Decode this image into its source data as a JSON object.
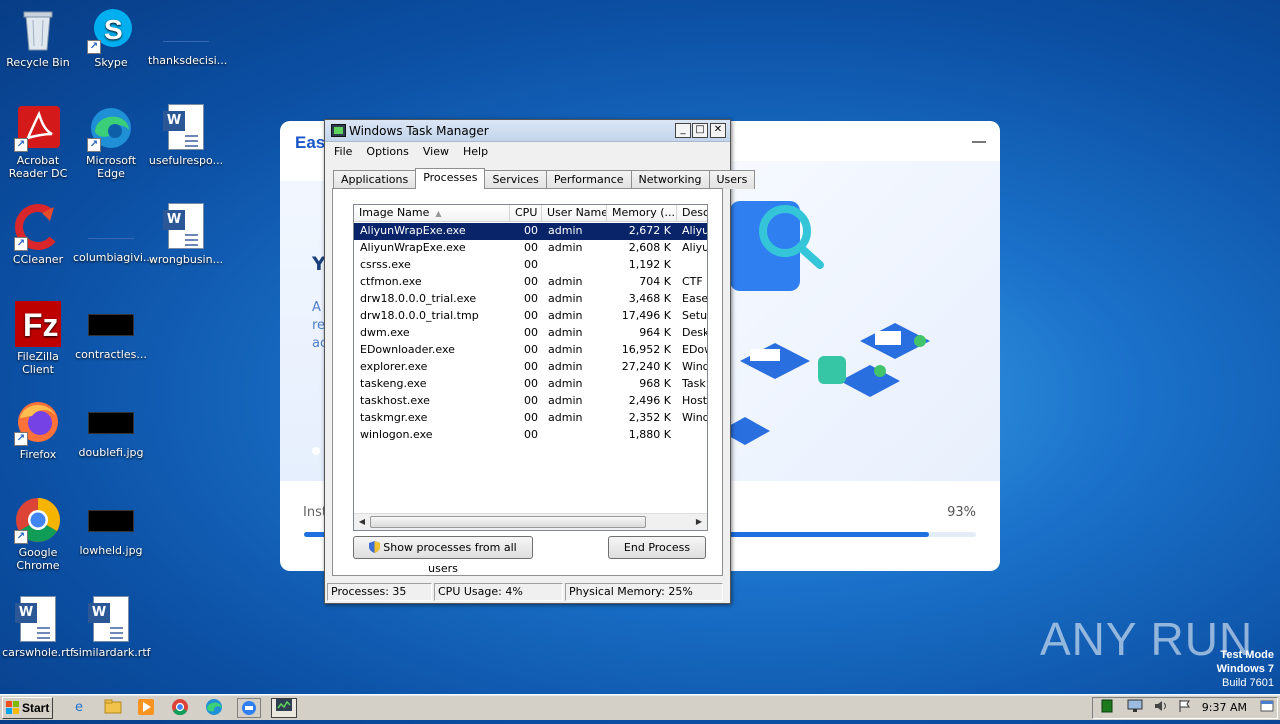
{
  "desktop": {
    "icons": [
      {
        "label": "Recycle Bin",
        "icon": "recycle-bin-icon"
      },
      {
        "label": "Skype",
        "icon": "skype-icon"
      },
      {
        "label": "thanksdecisi...",
        "icon": "file-icon"
      },
      {
        "label": "Acrobat Reader DC",
        "icon": "acrobat-icon"
      },
      {
        "label": "Microsoft Edge",
        "icon": "edge-icon"
      },
      {
        "label": "usefulrespo...",
        "icon": "word-doc-icon"
      },
      {
        "label": "CCleaner",
        "icon": "ccleaner-icon"
      },
      {
        "label": "columbiagivi...",
        "icon": "file-icon"
      },
      {
        "label": "wrongbusin...",
        "icon": "word-doc-icon"
      },
      {
        "label": "FileZilla Client",
        "icon": "filezilla-icon"
      },
      {
        "label": "contractles...",
        "icon": "image-icon"
      },
      {
        "label": "Firefox",
        "icon": "firefox-icon"
      },
      {
        "label": "doublefi.jpg",
        "icon": "image-icon"
      },
      {
        "label": "Google Chrome",
        "icon": "chrome-icon"
      },
      {
        "label": "lowheld.jpg",
        "icon": "image-icon"
      },
      {
        "label": "carswhole.rtf",
        "icon": "word-doc-icon"
      },
      {
        "label": "similardark.rtf",
        "icon": "word-doc-icon"
      }
    ]
  },
  "installer": {
    "brand": "Eas",
    "heading_fragment": "Y",
    "body_fragment": "A re ac",
    "progress_label": "Inst",
    "progress_percent": "93%",
    "progress_value": 0.93
  },
  "taskmanager": {
    "title": "Windows Task Manager",
    "window_buttons": {
      "minimize": "_",
      "maximize": "□",
      "close": "✕"
    },
    "menu": [
      "File",
      "Options",
      "View",
      "Help"
    ],
    "tabs": [
      "Applications",
      "Processes",
      "Services",
      "Performance",
      "Networking",
      "Users"
    ],
    "active_tab": "Processes",
    "columns": [
      "Image Name",
      "CPU",
      "User Name",
      "Memory (...",
      "Desc"
    ],
    "processes": [
      {
        "name": "AliyunWrapExe.exe",
        "cpu": "00",
        "user": "admin",
        "mem": "2,672 K",
        "desc": "Aliyu",
        "selected": true
      },
      {
        "name": "AliyunWrapExe.exe",
        "cpu": "00",
        "user": "admin",
        "mem": "2,608 K",
        "desc": "Aliyu"
      },
      {
        "name": "csrss.exe",
        "cpu": "00",
        "user": "",
        "mem": "1,192 K",
        "desc": ""
      },
      {
        "name": "ctfmon.exe",
        "cpu": "00",
        "user": "admin",
        "mem": "704 K",
        "desc": "CTF I"
      },
      {
        "name": "drw18.0.0.0_trial.exe",
        "cpu": "00",
        "user": "admin",
        "mem": "3,468 K",
        "desc": "Ease"
      },
      {
        "name": "drw18.0.0.0_trial.tmp",
        "cpu": "00",
        "user": "admin",
        "mem": "17,496 K",
        "desc": "Setup"
      },
      {
        "name": "dwm.exe",
        "cpu": "00",
        "user": "admin",
        "mem": "964 K",
        "desc": "Desk"
      },
      {
        "name": "EDownloader.exe",
        "cpu": "00",
        "user": "admin",
        "mem": "16,952 K",
        "desc": "EDow"
      },
      {
        "name": "explorer.exe",
        "cpu": "00",
        "user": "admin",
        "mem": "27,240 K",
        "desc": "Wind"
      },
      {
        "name": "taskeng.exe",
        "cpu": "00",
        "user": "admin",
        "mem": "968 K",
        "desc": "Task"
      },
      {
        "name": "taskhost.exe",
        "cpu": "00",
        "user": "admin",
        "mem": "2,496 K",
        "desc": "Host"
      },
      {
        "name": "taskmgr.exe",
        "cpu": "00",
        "user": "admin",
        "mem": "2,352 K",
        "desc": "Wind"
      },
      {
        "name": "winlogon.exe",
        "cpu": "00",
        "user": "",
        "mem": "1,880 K",
        "desc": ""
      }
    ],
    "show_all_button": "Show processes from all users",
    "end_process_button": "End Process",
    "status": {
      "processes": "Processes: 35",
      "cpu": "CPU Usage: 4%",
      "memory": "Physical Memory: 25%"
    }
  },
  "taskbar": {
    "start_label": "Start",
    "clock": "9:37 AM",
    "pinned": [
      "ie-icon",
      "explorer-icon",
      "media-player-icon",
      "chrome-icon",
      "edge-icon",
      "installer-icon",
      "taskmanager-icon"
    ]
  },
  "watermark": {
    "text": "ANY RUN",
    "test_mode": "Test Mode",
    "os": "Windows 7",
    "build": "Build 7601"
  },
  "colors": {
    "selection": "#0a246a",
    "installer_accent": "#1e6fe0",
    "desktop_bg": "#1a70c8"
  }
}
